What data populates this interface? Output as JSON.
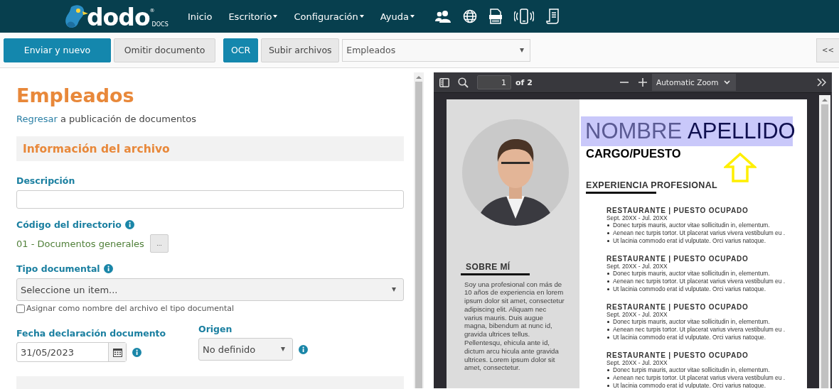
{
  "navbar": {
    "logo": {
      "name": "dodo",
      "mark": "®",
      "sub": "DOCS"
    },
    "menu": [
      {
        "label": "Inicio",
        "dropdown": false
      },
      {
        "label": "Escritorio",
        "dropdown": true
      },
      {
        "label": "Configuración",
        "dropdown": true
      },
      {
        "label": "Ayuda",
        "dropdown": true
      }
    ]
  },
  "toolbar": {
    "buttons": [
      {
        "label": "Enviar y nuevo",
        "kind": "primary"
      },
      {
        "label": "Omitir documento",
        "kind": "default"
      },
      {
        "label": "OCR",
        "kind": "primary"
      },
      {
        "label": "Subir archivos",
        "kind": "default"
      }
    ],
    "form_select": "Empleados",
    "collapse_button": "<<"
  },
  "form": {
    "title": "Empleados",
    "back_link": {
      "link": "Regresar",
      "text": "a publicación de documentos"
    },
    "section": "Información del archivo",
    "description": {
      "label": "Descripción"
    },
    "directory": {
      "label": "Código del directorio",
      "value": "01 - Documentos generales",
      "button": "..."
    },
    "document_type": {
      "label": "Tipo documental",
      "value": "Seleccione un item..."
    },
    "assign_name_checkbox": {
      "label": "Asignar como nombre del archivo el tipo documental",
      "checked": false
    },
    "declaration_date": {
      "label": "Fecha declaración documento",
      "value": "31/05/2023"
    },
    "origin": {
      "label": "Origen",
      "value": "No definido"
    }
  },
  "viewer": {
    "page": "1",
    "page_count": "of 2",
    "zoom": "Automatic Zoom",
    "document": {
      "name": {
        "first": "NOMBRE",
        "last": "APELLIDO",
        "highlighted": true
      },
      "job_title": "CARGO/PUESTO",
      "experience_heading": "EXPERIENCIA PROFESIONAL",
      "about_heading": "SOBRE MÍ",
      "about_text": "Soy una profesional con más de 10 años de experiencia en lorem ipsum dolor sit amet, consectetur adipiscing elit. Aliquam nec varius mauris. Duis augue magna, bibendum at nunc id, gravida ultrices tellus. Pellentesqu, ehicula ante id, dictum arcu hicula ante gravida ultrices. Lorem ipsum dolor sit amet, consectetur.",
      "jobs": [
        {
          "title": "RESTAURANTE | PUESTO OCUPADO",
          "dates": "Sept. 20XX - Jul. 20XX",
          "bullets": [
            "Donec turpis mauris, auctor vitae sollicitudin in, elementum.",
            "Aenean nec turpis tortor. Ut placerat varius vivera vestibulum eu .",
            "Ut lacinia commodo erat id vulputate. Orci varius natoque."
          ]
        },
        {
          "title": "RESTAURANTE | PUESTO OCUPADO",
          "dates": "Sept. 20XX - Jul. 20XX",
          "bullets": [
            "Donec turpis mauris, auctor vitae sollicitudin in, elementum.",
            "Aenean nec turpis tortor. Ut placerat varius vivera vestibulum eu .",
            "Ut lacinia commodo erat id vulputate. Orci varius natoque."
          ]
        },
        {
          "title": "RESTAURANTE | PUESTO OCUPADO",
          "dates": "Sept. 20XX - Jul. 20XX",
          "bullets": [
            "Donec turpis mauris, auctor vitae sollicitudin in, elementum.",
            "Aenean nec turpis tortor. Ut placerat varius vivera vestibulum eu .",
            "Ut lacinia commodo erat id vulputate. Orci varius natoque."
          ]
        },
        {
          "title": "RESTAURANTE | PUESTO OCUPADO",
          "dates": "Sept. 20XX - Jul. 20XX",
          "bullets": [
            "Donec turpis mauris, auctor vitae sollicitudin in, elementum.",
            "Aenean nec turpis tortor. Ut placerat varius vivera vestibulum eu .",
            "Ut lacinia commodo erat id vulputate. Orci varius natoque."
          ]
        }
      ]
    }
  }
}
